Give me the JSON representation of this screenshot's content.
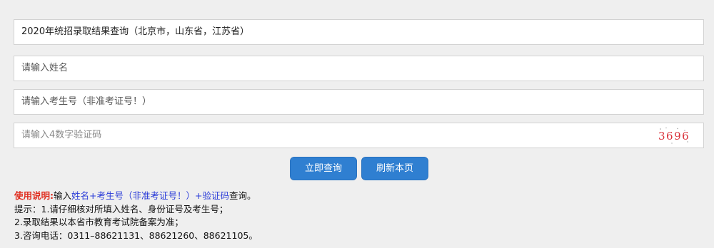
{
  "form": {
    "query_type_value": "2020年统招录取结果查询（北京市，山东省，江苏省）",
    "name_placeholder": "请输入姓名",
    "exam_id_placeholder": "请输入考生号（非准考证号！）",
    "captcha_placeholder": "请输入4数字验证码",
    "captcha_code": "3696",
    "captcha_color": "#d9313a"
  },
  "buttons": {
    "query_label": "立即查询",
    "refresh_label": "刷新本页"
  },
  "instructions": {
    "usage_label": "使用说明:",
    "usage_pre": "输入",
    "usage_name": "姓名",
    "usage_plus1": "+",
    "usage_exam": "考生号（非准考证号！）",
    "usage_plus2": "+",
    "usage_captcha": "验证码",
    "usage_post": "查询。",
    "tip_1": "提示：1.请仔细核对所填入姓名、身份证号及考生号；",
    "tip_2": "2.录取结果以本省市教育考试院备案为准；",
    "tip_3": "3.咨询电话：0311–88621131、88621260、88621105。"
  }
}
